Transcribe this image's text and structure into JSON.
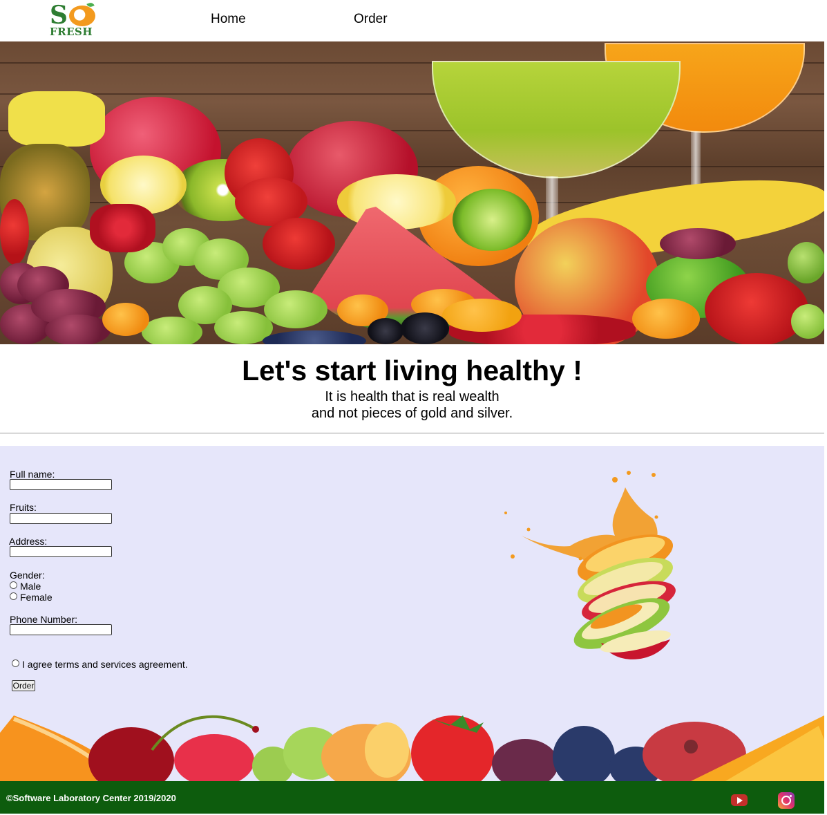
{
  "nav": {
    "logo_top": "S",
    "logo_bottom": "FRESH",
    "links": [
      "Home",
      "Order"
    ]
  },
  "hero": {
    "headline": "Let's start living healthy !",
    "quote_line1": "It is health that is real wealth",
    "quote_line2": "and not pieces of gold and silver."
  },
  "form": {
    "fullname_label": "Full name:",
    "fruits_label": "Fruits:",
    "address_label": "Address:",
    "gender_label": "Gender:",
    "gender_options": [
      "Male",
      "Female"
    ],
    "phone_label": "Phone Number:",
    "agree_label": "I agree terms and services agreement.",
    "order_button": "Order"
  },
  "footer": {
    "copyright": "©Software Laboratory Center 2019/2020",
    "social_icons": [
      "youtube-icon",
      "instagram-icon"
    ]
  },
  "colors": {
    "form_bg": "#e6e6fa",
    "footer_bg": "#0d5c0d",
    "logo_green": "#2e7d32",
    "logo_orange": "#f39a1e"
  }
}
